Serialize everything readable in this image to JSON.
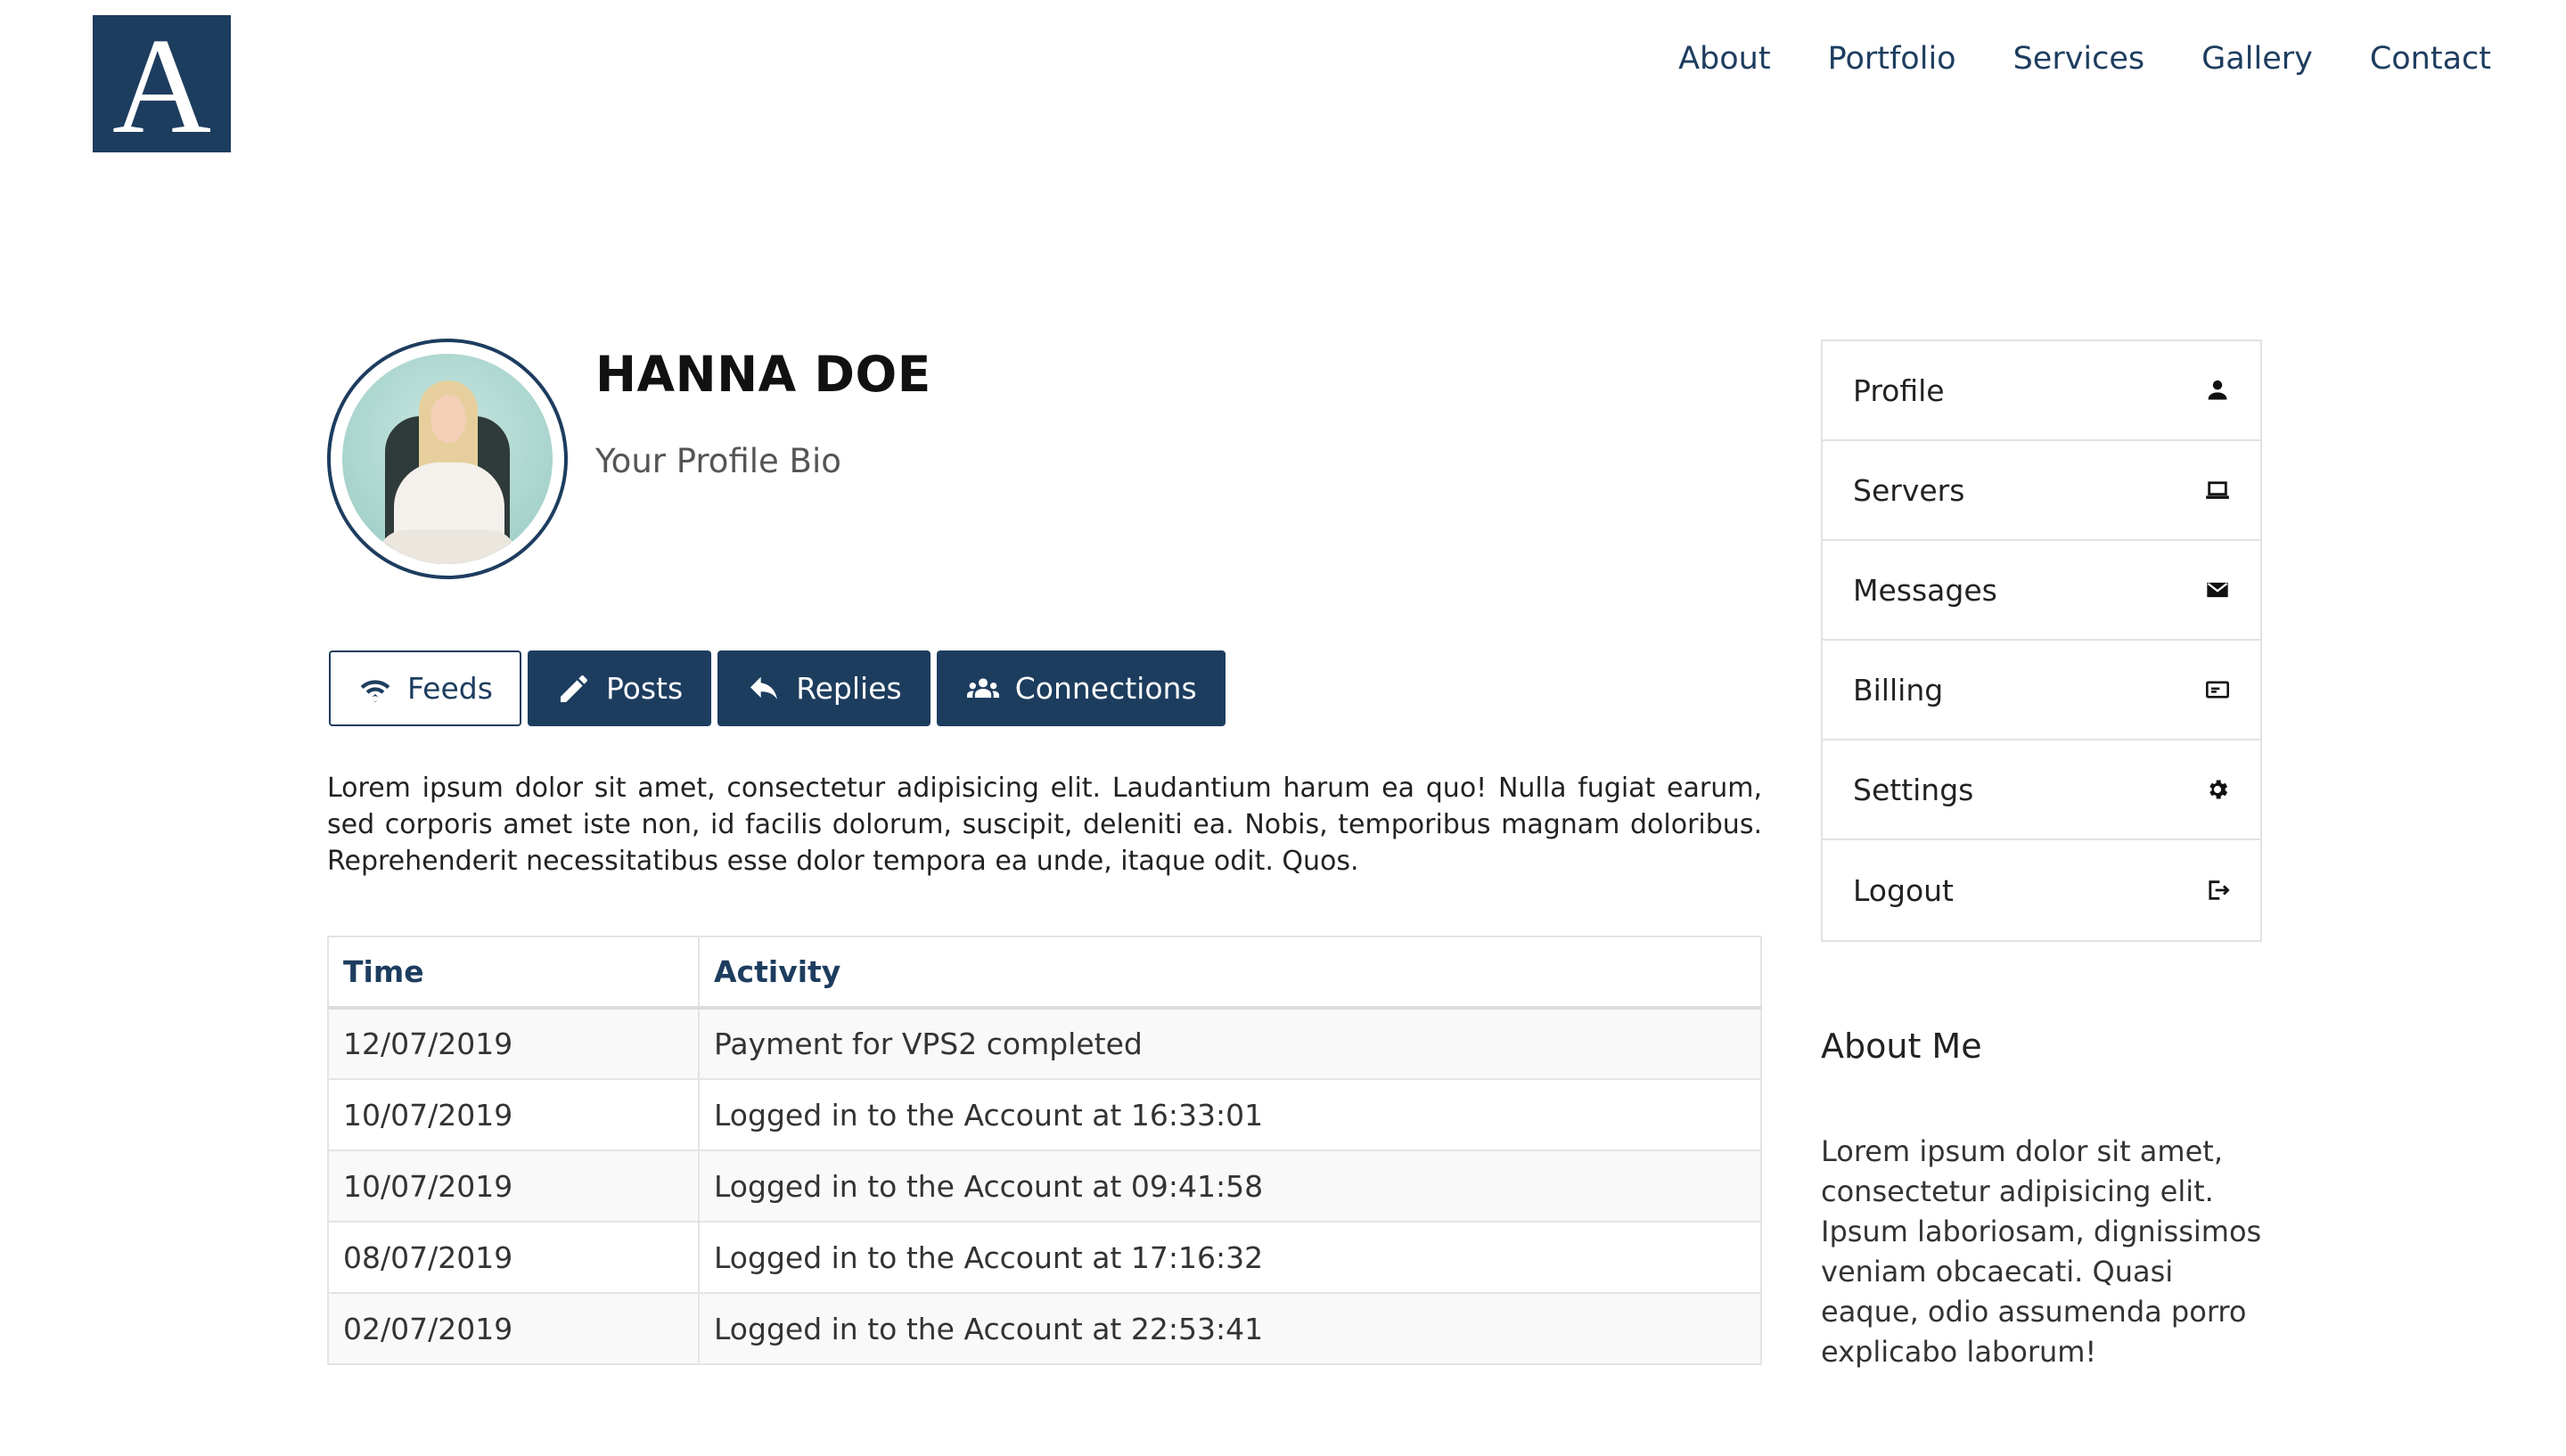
{
  "brand": {
    "logo_letter": "A",
    "logo_color": "#1d3d5f"
  },
  "nav": {
    "items": [
      "About",
      "Portfolio",
      "Services",
      "Gallery",
      "Contact"
    ]
  },
  "profile": {
    "name": "HANNA DOE",
    "bio": "Your Profile Bio"
  },
  "tabs": [
    {
      "label": "Feeds",
      "icon": "wifi-icon",
      "active": true
    },
    {
      "label": "Posts",
      "icon": "pencil-icon",
      "active": false
    },
    {
      "label": "Replies",
      "icon": "reply-icon",
      "active": false
    },
    {
      "label": "Connections",
      "icon": "users-icon",
      "active": false
    }
  ],
  "description": "Lorem ipsum dolor sit amet, consectetur adipisicing elit. Laudantium harum ea quo! Nulla fugiat earum, sed corporis amet iste non, id facilis dolorum, suscipit, deleniti ea. Nobis, temporibus magnam doloribus. Reprehenderit necessitatibus esse dolor tempora ea unde, itaque odit. Quos.",
  "activity_table": {
    "headers": [
      "Time",
      "Activity"
    ],
    "rows": [
      [
        "12/07/2019",
        "Payment for VPS2 completed"
      ],
      [
        "10/07/2019",
        "Logged in to the Account at 16:33:01"
      ],
      [
        "10/07/2019",
        "Logged in to the Account at 09:41:58"
      ],
      [
        "08/07/2019",
        "Logged in to the Account at 17:16:32"
      ],
      [
        "02/07/2019",
        "Logged in to the Account at 22:53:41"
      ]
    ]
  },
  "side_menu": {
    "items": [
      {
        "label": "Profile",
        "icon": "user-icon"
      },
      {
        "label": "Servers",
        "icon": "laptop-icon"
      },
      {
        "label": "Messages",
        "icon": "envelope-icon"
      },
      {
        "label": "Billing",
        "icon": "credit-card-icon"
      },
      {
        "label": "Settings",
        "icon": "gear-icon"
      },
      {
        "label": "Logout",
        "icon": "logout-icon"
      }
    ]
  },
  "about": {
    "title": "About Me",
    "text": "Lorem ipsum dolor sit amet, consectetur adipisicing elit. Ipsum laboriosam, dignissimos veniam obcaecati. Quasi eaque, odio assumenda porro explicabo laborum!"
  },
  "colors": {
    "accent": "#1d3d5f",
    "border": "#e2e2e2"
  }
}
